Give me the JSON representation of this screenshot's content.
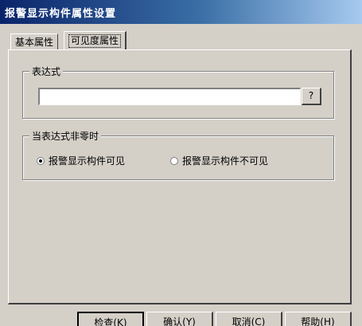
{
  "window": {
    "title": "报警显示构件属性设置"
  },
  "tabs": [
    {
      "label": "基本属性",
      "active": false
    },
    {
      "label": "可见度属性",
      "active": true
    }
  ],
  "expression_group": {
    "title": "表达式",
    "input_value": "",
    "help_button_label": "?"
  },
  "nonzero_group": {
    "title": "当表达式非零时",
    "options": [
      {
        "label": "报警显示构件可见",
        "checked": true
      },
      {
        "label": "报警显示构件不可见",
        "checked": false
      }
    ]
  },
  "buttons": {
    "check": "检查(K)",
    "ok": "确认(Y)",
    "cancel": "取消(C)",
    "help": "帮助(H)"
  },
  "colors": {
    "title_bar_start": "#0a246a",
    "title_bar_end": "#a6caf0",
    "face": "#d4d0c8"
  }
}
